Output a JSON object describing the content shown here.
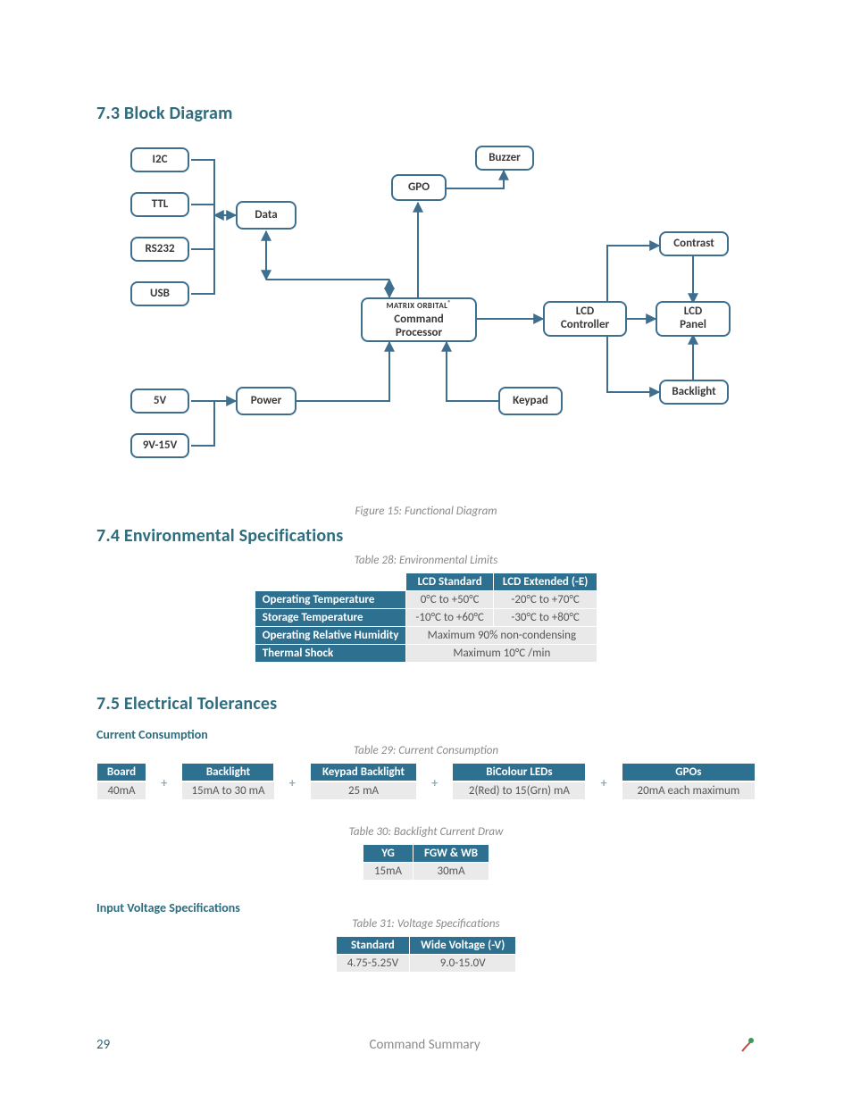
{
  "sections": {
    "block_diagram_heading": "7.3 Block Diagram",
    "env_heading": "7.4 Environmental Specifications",
    "elec_heading": "7.5 Electrical Tolerances"
  },
  "diagram": {
    "caption": "Figure 15: Functional Diagram",
    "nodes": {
      "i2c": "I2C",
      "ttl": "TTL",
      "rs232": "RS232",
      "usb": "USB",
      "v5": "5V",
      "v9_15": "9V-15V",
      "data": "Data",
      "power": "Power",
      "gpo": "GPO",
      "brand": "MATRIX ORBITAL",
      "processor_l1": "Command",
      "processor_l2": "Processor",
      "keypad": "Keypad",
      "buzzer": "Buzzer",
      "lcd_controller_l1": "LCD",
      "lcd_controller_l2": "Controller",
      "lcd_panel_l1": "LCD",
      "lcd_panel_l2": "Panel",
      "contrast": "Contrast",
      "backlight": "Backlight"
    }
  },
  "env_table": {
    "caption": "Table 28: Environmental Limits",
    "col1": "LCD Standard",
    "col2": "LCD Extended (-E)",
    "rows": [
      {
        "label": "Operating Temperature",
        "c1": "0°C to +50°C",
        "c2": "-20°C to +70°C"
      },
      {
        "label": "Storage Temperature",
        "c1": "-10°C to +60°C",
        "c2": "-30°C to +80°C"
      },
      {
        "label": "Operating Relative Humidity",
        "span": "Maximum 90% non-condensing"
      },
      {
        "label": "Thermal Shock",
        "span": "Maximum 10°C /min"
      }
    ]
  },
  "current_consumption": {
    "sub_heading": "Current Consumption",
    "caption": "Table 29: Current Consumption",
    "blocks": [
      {
        "head": "Board",
        "val": "40mA"
      },
      {
        "head": "Backlight",
        "val": "15mA to 30 mA"
      },
      {
        "head": "Keypad Backlight",
        "val": "25 mA"
      },
      {
        "head": "BiColour LEDs",
        "val": "2(Red) to 15(Grn) mA"
      },
      {
        "head": "GPOs",
        "val": "20mA each maximum"
      }
    ],
    "plus": "+"
  },
  "backlight_draw": {
    "caption": "Table 30: Backlight Current Draw",
    "cols": [
      "YG",
      "FGW & WB"
    ],
    "vals": [
      "15mA",
      "30mA"
    ]
  },
  "voltage": {
    "sub_heading": "Input Voltage Specifications",
    "caption": "Table 31: Voltage Specifications",
    "cols": [
      "Standard",
      "Wide Voltage (-V)"
    ],
    "vals": [
      "4.75-5.25V",
      "9.0-15.0V"
    ]
  },
  "footer": {
    "page_number": "29",
    "title": "Command Summary"
  }
}
